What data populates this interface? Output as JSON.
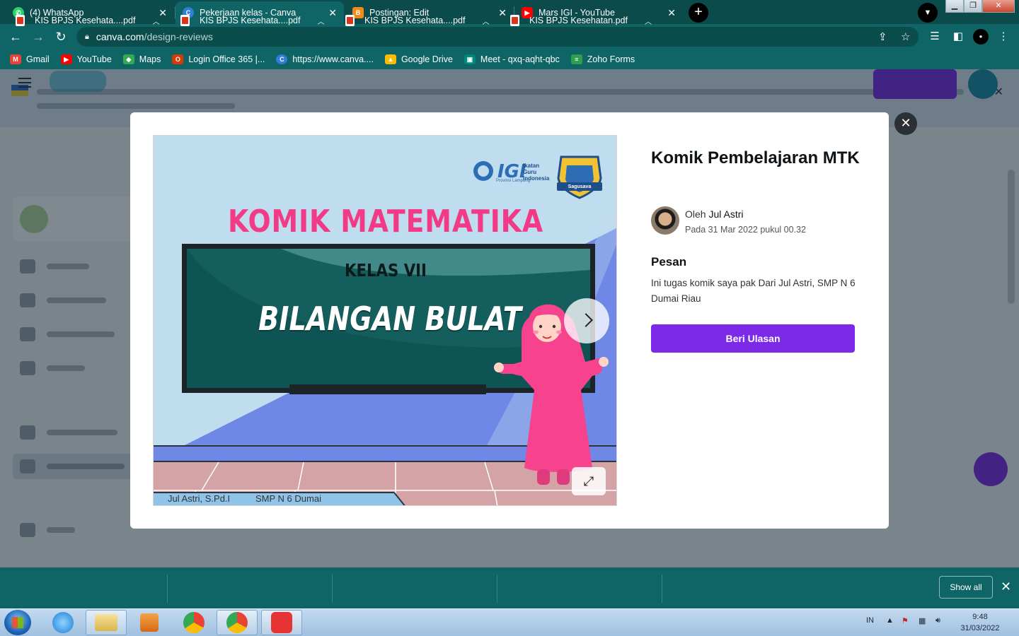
{
  "browser": {
    "tabs": [
      {
        "label": "(4) WhatsApp",
        "icon": "whatsapp-icon",
        "color": "#25d366"
      },
      {
        "label": "Pekerjaan kelas - Canva",
        "icon": "canva-icon",
        "color": "#2f7fd8"
      },
      {
        "label": "Postingan: Edit",
        "icon": "blogger-icon",
        "color": "#f08a19"
      },
      {
        "label": "Mars IGI - YouTube",
        "icon": "youtube-icon",
        "color": "#ff0000"
      }
    ],
    "url_host": "canva.com",
    "url_path": "/design-reviews",
    "bookmarks": [
      {
        "label": "Gmail",
        "icon": "gmail-icon",
        "color": "#ea4335"
      },
      {
        "label": "YouTube",
        "icon": "youtube-icon",
        "color": "#ff0000"
      },
      {
        "label": "Maps",
        "icon": "maps-icon",
        "color": "#34a853"
      },
      {
        "label": "Login Office 365 |...",
        "icon": "office-icon",
        "color": "#d83b01"
      },
      {
        "label": "https://www.canva....",
        "icon": "canva-icon",
        "color": "#2f7fd8"
      },
      {
        "label": "Google Drive",
        "icon": "drive-icon",
        "color": "#fbbc04"
      },
      {
        "label": "Meet - qxq-aqht-qbc",
        "icon": "meet-icon",
        "color": "#00897b"
      },
      {
        "label": "Zoho Forms",
        "icon": "zoho-icon",
        "color": "#2e9e4f"
      }
    ]
  },
  "modal": {
    "title": "Komik Pembelajaran MTK",
    "author_prefix": "Oleh",
    "author": "Jul Astri",
    "date": "Pada 31 Mar 2022 pukul 00.32",
    "message_heading": "Pesan",
    "message": "Ini tugas komik saya pak Dari Jul Astri, SMP N 6 Dumai Riau",
    "review_button": "Beri Ulasan",
    "preview": {
      "title": "KOMIK MATEMATIKA",
      "class": "KELAS VII",
      "topic": "BILANGAN BULAT",
      "logo_text": "IGI",
      "logo_sub_1": "Ikatan",
      "logo_sub_2": "Guru",
      "logo_sub_3": "Indonesia",
      "logo_province": "Provinsi Lampung",
      "badge": "Sagusava",
      "footer_name": "Jul Astri, S.Pd.I",
      "footer_school": "SMP N 6 Dumai"
    }
  },
  "downloads": {
    "items": [
      "KIS BPJS Kesehata....pdf",
      "KIS BPJS Kesehata....pdf",
      "KIS BPJS Kesehata....pdf",
      "KIS BPJS Kesehatan.pdf"
    ],
    "show_all": "Show all"
  },
  "taskbar": {
    "lang": "IN",
    "time": "9:48",
    "date": "31/03/2022"
  },
  "colors": {
    "chrome_dark": "#0b4b4c",
    "chrome": "#0f6565",
    "canva_purple": "#7d2ae8",
    "comic_pink": "#f33a86"
  }
}
